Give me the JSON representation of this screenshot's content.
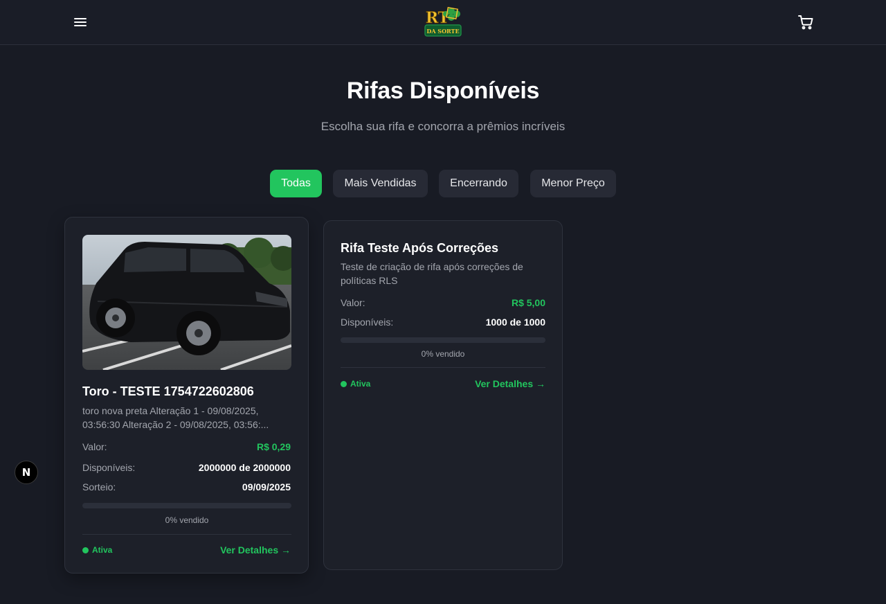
{
  "header": {
    "logo_text_top": "RT",
    "logo_text_bottom": "DA SORTE",
    "menu_icon": "hamburger-menu-icon",
    "cart_icon": "shopping-cart-icon"
  },
  "main": {
    "title": "Rifas Disponíveis",
    "subtitle": "Escolha sua rifa e concorra a prêmios incríveis"
  },
  "filters": [
    {
      "label": "Todas",
      "active": true
    },
    {
      "label": "Mais Vendidas",
      "active": false
    },
    {
      "label": "Encerrando",
      "active": false
    },
    {
      "label": "Menor Preço",
      "active": false
    }
  ],
  "raffles": [
    {
      "title": "Toro - TESTE 1754722602806",
      "description": "toro nova preta Alteração 1 - 09/08/2025, 03:56:30 Alteração 2 - 09/08/2025, 03:56:...",
      "value_label": "Valor:",
      "value": "R$ 0,29",
      "available_label": "Disponíveis:",
      "available": "2000000 de 2000000",
      "draw_label": "Sorteio:",
      "draw_date": "09/09/2025",
      "progress_fraction": 0,
      "progress_text": "0% vendido",
      "status": "Ativa",
      "details_label": "Ver Detalhes →"
    },
    {
      "title": "Rifa Teste Após Correções",
      "description": "Teste de criação de rifa após correções de políticas RLS",
      "value_label": "Valor:",
      "value": "R$ 5,00",
      "available_label": "Disponíveis:",
      "available": "1000 de 1000",
      "progress_fraction": 0,
      "progress_text": "0% vendido",
      "status": "Ativa",
      "details_label": "Ver Detalhes →"
    }
  ],
  "dev_badge": {
    "letter": "N"
  },
  "colors": {
    "accent": "#22c55e",
    "background": "#181b24",
    "card": "#1d2029"
  }
}
